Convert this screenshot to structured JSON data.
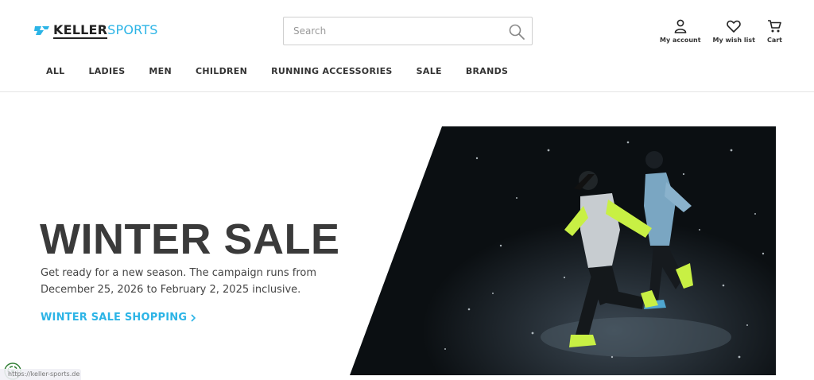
{
  "brand": {
    "part1": "KELLER",
    "part2": "SPORTS"
  },
  "search": {
    "placeholder": "Search",
    "value": ""
  },
  "account_links": [
    {
      "icon": "user-icon",
      "label": "My account"
    },
    {
      "icon": "heart-icon",
      "label": "My wish list"
    },
    {
      "icon": "cart-icon",
      "label": "Cart"
    }
  ],
  "nav": [
    "ALL",
    "LADIES",
    "MEN",
    "CHILDREN",
    "RUNNING ACCESSORIES",
    "SALE",
    "BRANDS"
  ],
  "hero": {
    "title": "WINTER SALE",
    "text": "Get ready for a new season. The campaign runs from December 25, 2026 to February 2, 2025 inclusive.",
    "cta": "WINTER SALE SHOPPING"
  },
  "status_bar": {
    "url": "https://keller-sports.de"
  },
  "colors": {
    "accent": "#2cb4e6",
    "text": "#333333",
    "hero_bg": "#0b0f12",
    "highlight": "#c8f044"
  }
}
